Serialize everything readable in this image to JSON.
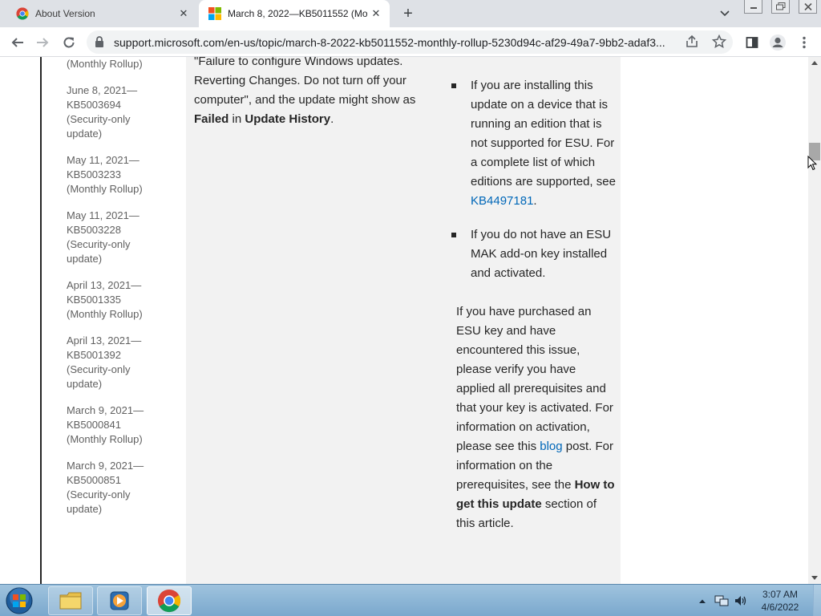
{
  "browser": {
    "tabs": [
      {
        "title": "About Version",
        "active": false
      },
      {
        "title": "March 8, 2022—KB5011552 (Mo",
        "active": true
      }
    ],
    "url": "support.microsoft.com/en-us/topic/march-8-2022-kb5011552-monthly-rollup-5230d94c-af29-49a7-9bb2-adaf3..."
  },
  "sidebar": {
    "items": [
      {
        "label": "(Monthly Rollup)"
      },
      {
        "label": "June 8, 2021—KB5003694 (Security-only update)"
      },
      {
        "label": "May 11, 2021—KB5003233 (Monthly Rollup)"
      },
      {
        "label": "May 11, 2021—KB5003228 (Security-only update)"
      },
      {
        "label": "April 13, 2021—KB5001335 (Monthly Rollup)"
      },
      {
        "label": "April 13, 2021—KB5001392 (Security-only update)"
      },
      {
        "label": "March 9, 2021—KB5000841 (Monthly Rollup)"
      },
      {
        "label": "March 9, 2021—KB5000851 (Security-only update)"
      }
    ]
  },
  "article": {
    "left_text_1": "\"Failure to configure Windows updates. Reverting Changes. Do not turn off your computer\", and the update might show as ",
    "left_bold_1": "Failed",
    "left_text_2": " in ",
    "left_bold_2": "Update History",
    "left_text_3": ".",
    "bullet_1_text": "If you are installing this update on a device that is running an edition that is not supported for ESU. For a complete list of which editions are supported, see ",
    "bullet_1_link": "KB4497181",
    "bullet_1_end": ".",
    "bullet_2_text": "If you do not have an ESU MAK add-on key installed and activated.",
    "para_text_1": "If you have purchased an ESU key and have encountered this issue, please verify you have applied all prerequisites and that your key is activated. For information on activation, please see this ",
    "para_link": "blog",
    "para_text_2": " post. For information on the prerequisites, see the ",
    "para_bold": "How to get this update",
    "para_text_3": " section of this article."
  },
  "clock": {
    "time": "3:07 AM",
    "date": "4/6/2022"
  },
  "colors": {
    "link": "#0067b8",
    "panel": "#f2f2f2",
    "tab_strip": "#dee1e6"
  }
}
